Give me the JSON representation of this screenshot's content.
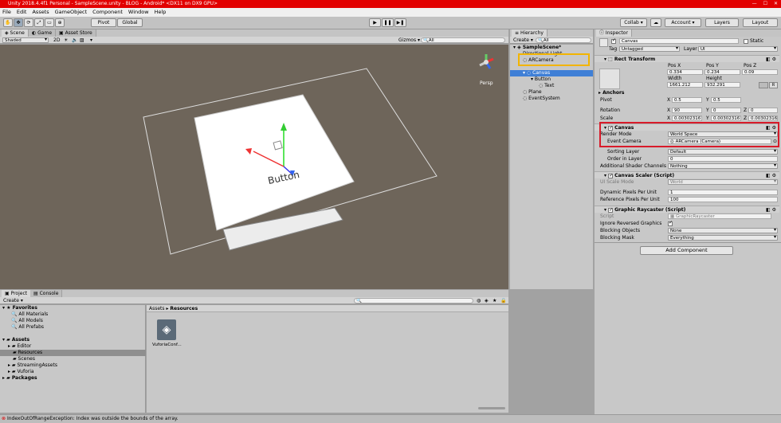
{
  "window": {
    "title": "Unity 2018.4.4f1 Personal - SampleScene.unity - BLOG - Android* <DX11 on DX9 GPU>"
  },
  "menu": [
    "File",
    "Edit",
    "Assets",
    "GameObject",
    "Component",
    "Window",
    "Help"
  ],
  "toolbar": {
    "pivot": "Pivot",
    "global": "Global",
    "collab": "Collab ▾",
    "account": "Account ▾",
    "layers": "Layers",
    "layout": "Layout"
  },
  "scene": {
    "tabs": [
      "Scene",
      "Game",
      "Asset Store"
    ],
    "shaded": "Shaded",
    "mode2d": "2D",
    "gizmos": "Gizmos ▾",
    "search": "All",
    "persp": "Persp",
    "button_text": "Button"
  },
  "hierarchy": {
    "tab": "Hierarchy",
    "create": "Create ▾",
    "search": "All",
    "scene": "SampleScene*",
    "items": [
      "Directional Light",
      "ARCamera",
      "Canvas",
      "Button",
      "Text",
      "Plane",
      "EventSystem"
    ]
  },
  "inspector": {
    "tab": "Inspector",
    "name": "Canvas",
    "static": "Static",
    "tag_label": "Tag",
    "tag": "Untagged",
    "layer_label": "Layer",
    "layer": "UI",
    "rect_transform": "Rect Transform",
    "pos_x_label": "Pos X",
    "pos_y_label": "Pos Y",
    "pos_z_label": "Pos Z",
    "pos_x": "0.334",
    "pos_y": "0.234",
    "pos_z": "0.09",
    "width_label": "Width",
    "height_label": "Height",
    "width": "1661.212",
    "height": "932.291",
    "anchors": "Anchors",
    "pivot_label": "Pivot",
    "pivot_x": "0.5",
    "pivot_y": "0.5",
    "rotation_label": "Rotation",
    "rot_x": "90",
    "rot_y": "0",
    "rot_z": "0",
    "scale_label": "Scale",
    "scale_x": "0.003023167",
    "scale_y": "0.003023167",
    "scale_z": "0.003023167",
    "x": "X",
    "y": "Y",
    "z": "Z",
    "r": "R",
    "canvas": "Canvas",
    "render_mode_label": "Render Mode",
    "render_mode": "World Space",
    "event_camera_label": "Event Camera",
    "event_camera": "ARCamera (Camera)",
    "sorting_layer_label": "Sorting Layer",
    "sorting_layer": "Default",
    "order_label": "Order in Layer",
    "order": "0",
    "shader_label": "Additional Shader Channels",
    "shader": "Nothing",
    "scaler": "Canvas Scaler (Script)",
    "ui_scale_label": "UI Scale Mode",
    "ui_scale": "World",
    "dyn_label": "Dynamic Pixels Per Unit",
    "dyn": "1",
    "ref_label": "Reference Pixels Per Unit",
    "ref": "100",
    "raycaster": "Graphic Raycaster (Script)",
    "script_label": "Script",
    "script": "GraphicRaycaster",
    "ignore_label": "Ignore Reversed Graphics",
    "blocking_label": "Blocking Objects",
    "blocking": "None",
    "mask_label": "Blocking Mask",
    "mask": "Everything",
    "add_component": "Add Component"
  },
  "project": {
    "tabs": [
      "Project",
      "Console"
    ],
    "create": "Create ▾",
    "favorites": "Favorites",
    "fav_items": [
      "All Materials",
      "All Models",
      "All Prefabs"
    ],
    "assets": "Assets",
    "asset_items": [
      "Editor",
      "Resources",
      "Scenes",
      "StreamingAssets",
      "Vuforia"
    ],
    "packages": "Packages",
    "breadcrumb_root": "Assets",
    "breadcrumb_sep": "▸",
    "breadcrumb_current": "Resources",
    "file": "VuforiaConf..."
  },
  "status": {
    "error": "IndexOutOfRangeException: Index was outside the bounds of the array."
  }
}
